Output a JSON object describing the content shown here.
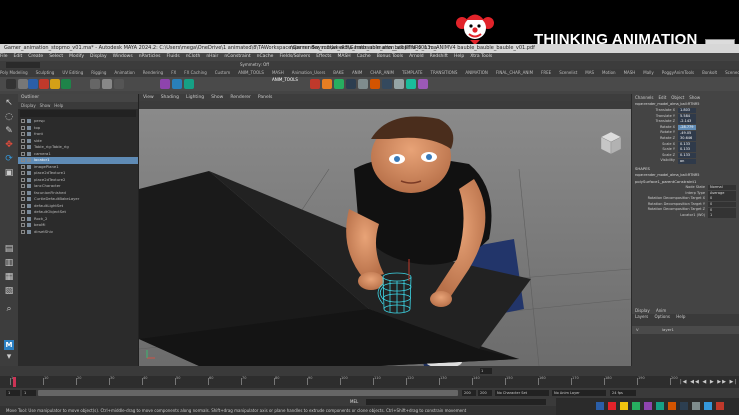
{
  "banner": {
    "brand_text": "THINKING ANIMATION",
    "accent_red": "#e2232a",
    "clown_icon": "clown-logo-icon"
  },
  "window": {
    "title": "Gamer_animation_stopmo_v01.ma* - Autodesk MAYA 2024.2: C:\\Users\\mega\\OneDrive\\1 animated\\8\\TAWorkspace\\Gamer Baysuit\\week3\\Gamer_animation_stopmo_v01.ma",
    "tab_text": "rope render_model_alma_hatbauble_ann_ball RTNR5_n3u_ANIMV4 bauble_bauble_bauble_v01.pdf",
    "bg": "#d7d7d7"
  },
  "menus": [
    "File",
    "Edit",
    "Create",
    "Select",
    "Modify",
    "Display",
    "Windows",
    "nParticles",
    "Fluids",
    "nCloth",
    "nHair",
    "nConstraint",
    "nCache",
    "Fields/Solvers",
    "Effects",
    "MASH",
    "Cache",
    "Bonus Tools",
    "Arnold",
    "Redshift",
    "Help",
    "Xtra Tools"
  ],
  "workspace_label": "Symmetry: Off",
  "shelf_tabs": [
    "Poly Modeling",
    "Sculpting",
    "UV Editing",
    "Rigging",
    "Animation",
    "Rendering",
    "FX",
    "FX Caching",
    "Custom",
    "ANIM_TOOLS",
    "MASH",
    "Animation_Users",
    "BAKE",
    "ANIM",
    "CHAR_ANIM",
    "TEMPLATE",
    "TRANSITIONS",
    "ANIMATION",
    "FINAL_CHAR_ANIM",
    "FREE",
    "Scenelist",
    "MAS",
    "Motion",
    "MASH",
    "Mally",
    "PoggyAnimTools",
    "Bonkolt",
    "Scenecrew",
    "Shadow",
    "TURTLE_Ver"
  ],
  "shelf_label": "ANIM_TOOLS",
  "outliner": {
    "title": "Outliner",
    "menu": [
      "Display",
      "Show",
      "Help"
    ],
    "items": [
      {
        "label": "persp",
        "selected": false
      },
      {
        "label": "top",
        "selected": false
      },
      {
        "label": "front",
        "selected": false
      },
      {
        "label": "side",
        "selected": false
      },
      {
        "label": "Table_rig:Table_rig",
        "selected": false
      },
      {
        "label": "camera1",
        "selected": false
      },
      {
        "label": "locator1",
        "selected": true
      },
      {
        "label": "imagePlane1",
        "selected": false
      },
      {
        "label": "place2dTexture1",
        "selected": false
      },
      {
        "label": "place2dTexture2",
        "selected": false
      },
      {
        "label": "lancCharacter",
        "selected": false
      },
      {
        "label": "facunionFinished",
        "selected": false
      },
      {
        "label": "CurtleDefaultBakeLayer",
        "selected": false
      },
      {
        "label": "defaultLightSet",
        "selected": false
      },
      {
        "label": "defaultObjectSet",
        "selected": false
      },
      {
        "label": "Rock_2",
        "selected": false
      },
      {
        "label": "beoMi",
        "selected": false
      },
      {
        "label": "dirsetShiv",
        "selected": false
      }
    ]
  },
  "viewport": {
    "menu": [
      "View",
      "Shading",
      "Lighting",
      "Show",
      "Renderer",
      "Panels"
    ],
    "field_value": "0.00",
    "field2": "1.00",
    "colorspace": "sRGB gamma (legacy)",
    "camera_label": "persp",
    "bg": "#7e7e7e"
  },
  "channel_box": {
    "tabs": [
      "Channels",
      "Edit",
      "Object",
      "Show"
    ],
    "node": "rope:render_model_alma_ball:RTNR5",
    "attrs": [
      {
        "k": "Translate X",
        "v": "1.803",
        "hl": false
      },
      {
        "k": "Translate Y",
        "v": "5.584",
        "hl": false
      },
      {
        "k": "Translate Z",
        "v": "-2.143",
        "hl": false
      },
      {
        "k": "Rotate X",
        "v": "-28.779",
        "hl": true
      },
      {
        "k": "Rotate Y",
        "v": "-49.05",
        "hl": false
      },
      {
        "k": "Rotate Z",
        "v": "30.646",
        "hl": false
      },
      {
        "k": "Scale X",
        "v": "0.133",
        "hl": false
      },
      {
        "k": "Scale Y",
        "v": "0.133",
        "hl": false
      },
      {
        "k": "Scale Z",
        "v": "0.133",
        "hl": false
      },
      {
        "k": "Visibility",
        "v": "on",
        "hl": false
      }
    ],
    "shapes_label": "SHAPES",
    "shape_node": "rope:render_model_alma_ball:RTNR5",
    "inputs_label": "polySurface1_parentConstraint1",
    "inputs": [
      {
        "k": "Node State",
        "v": "Normal"
      },
      {
        "k": "Interp Type",
        "v": "Average"
      },
      {
        "k": "Rotation Decomposition Target X",
        "v": "0"
      },
      {
        "k": "Rotation Decomposition Target Y",
        "v": "0"
      },
      {
        "k": "Rotation Decomposition Target Z",
        "v": "0"
      },
      {
        "k": "Locator1 (W0)",
        "v": "1"
      }
    ],
    "layer_tabs": [
      "Display",
      "Anim"
    ],
    "layer_menu": [
      "Layers",
      "Options",
      "Help"
    ],
    "layer_vis": "V",
    "layer_name": "layer1"
  },
  "timeline": {
    "start": "1",
    "end": "200",
    "range_start": "1",
    "range_end": "200",
    "current": "1",
    "fps": "24 fps",
    "char_set": "No Character Set",
    "anim_layer": "No Anim Layer",
    "ticks": [
      "1",
      "10",
      "20",
      "30",
      "40",
      "50",
      "60",
      "70",
      "80",
      "90",
      "100",
      "110",
      "120",
      "130",
      "140",
      "150",
      "160",
      "170",
      "180",
      "190",
      "200"
    ],
    "playback": "|◀ ◀◀ ◀ ▶ ▶▶ ▶|"
  },
  "help_line": "Move Tool: Use manipulator to move object(s). Ctrl+middle-drag to move components along normals. Shift+drag manipulator axis or plane handles to extrude components or clone objects. Ctrl+Shift+drag to constrain movement",
  "mel_label": "MEL"
}
